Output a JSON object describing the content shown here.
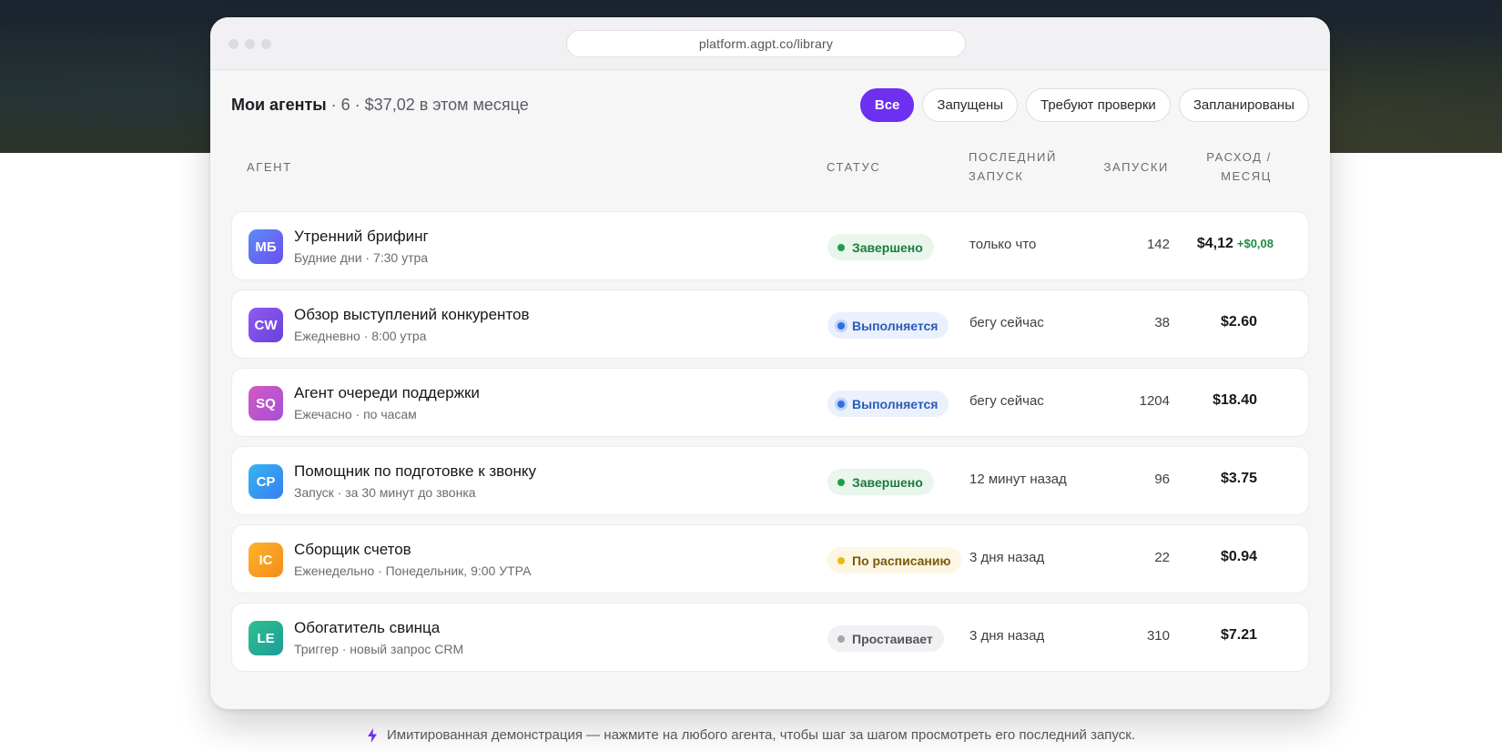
{
  "browser": {
    "url": "platform.agpt.co/library"
  },
  "header": {
    "title": "Мои агенты",
    "meta": "· 6 · $37,02 в этом месяце",
    "filters": [
      "Все",
      "Запущены",
      "Требуют проверки",
      "Запланированы"
    ],
    "active_filter": "Все"
  },
  "columns": {
    "agent": "АГЕНТ",
    "status": "СТАТУС",
    "last_run": "ПОСЛЕДНИЙ ЗАПУСК",
    "runs": "ЗАПУСКИ",
    "cost": "РАСХОД / МЕСЯЦ"
  },
  "agents": [
    {
      "initials": "МБ",
      "color": "#6a5cf6",
      "name": "Утренний брифинг",
      "schedule": "Будние дни · 7:30 утра",
      "status": "Завершено",
      "status_kind": "done",
      "last_run": "только что",
      "runs": "142",
      "cost": "$4,12",
      "delta": "+$0,08"
    },
    {
      "initials": "CW",
      "color": "#7b4fe8",
      "name": "Обзор выступлений конкурентов",
      "schedule": "Ежедневно · 8:00 утра",
      "status": "Выполняется",
      "status_kind": "running",
      "last_run": "бегу сейчас",
      "runs": "38",
      "cost": "$2.60"
    },
    {
      "initials": "SQ",
      "color": "#c352c9",
      "name": "Агент очереди поддержки",
      "schedule": "Ежечасно · по часам",
      "status": "Выполняется",
      "status_kind": "running",
      "last_run": "бегу сейчас",
      "runs": "1204",
      "cost": "$18.40"
    },
    {
      "initials": "CP",
      "color": "#2f9df3",
      "name": "Помощник по подготовке к звонку",
      "schedule": "Запуск · за 30 минут до звонка",
      "status": "Завершено",
      "status_kind": "done",
      "last_run": "12 минут назад",
      "runs": "96",
      "cost": "$3.75"
    },
    {
      "initials": "IC",
      "color": "#f5a01c",
      "name": "Сборщик счетов",
      "schedule": "Еженедельно · Понедельник, 9:00 УТРА",
      "status": "По расписанию",
      "status_kind": "sched",
      "last_run": "3 дня назад",
      "runs": "22",
      "cost": "$0.94"
    },
    {
      "initials": "LE",
      "color": "#22b08a",
      "name": "Обогатитель свинца",
      "schedule": "Триггер · новый запрос CRM",
      "status": "Простаивает",
      "status_kind": "idle",
      "last_run": "3 дня назад",
      "runs": "310",
      "cost": "$7.21"
    }
  ],
  "footer": {
    "note": "Имитированная демонстрация — нажмите на любого агента, чтобы шаг за шагом просмотреть его последний запуск.",
    "icon": "lightning-icon",
    "accent": "#6d2ff0"
  }
}
